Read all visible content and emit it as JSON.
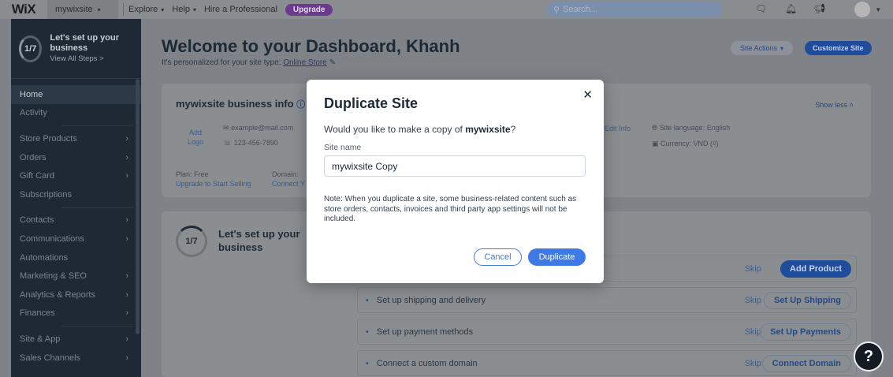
{
  "topbar": {
    "logo": "WiX",
    "site_name": "mywixsite",
    "nav": [
      "Explore",
      "Help",
      "Hire a Professional"
    ],
    "upgrade_label": "Upgrade",
    "search_placeholder": "Search..."
  },
  "sidebar": {
    "setup_progress": "1/7",
    "setup_title": "Let's set up your business",
    "setup_link": "View All Steps >",
    "items": [
      {
        "label": "Home",
        "has_chevron": false,
        "active": true
      },
      {
        "label": "Activity",
        "has_chevron": false
      },
      {
        "label": "Store Products",
        "has_chevron": true
      },
      {
        "label": "Orders",
        "has_chevron": true
      },
      {
        "label": "Gift Card",
        "has_chevron": true
      },
      {
        "label": "Subscriptions",
        "has_chevron": false
      },
      {
        "label": "Contacts",
        "has_chevron": true
      },
      {
        "label": "Communications",
        "has_chevron": true
      },
      {
        "label": "Automations",
        "has_chevron": false
      },
      {
        "label": "Marketing & SEO",
        "has_chevron": true
      },
      {
        "label": "Analytics & Reports",
        "has_chevron": true
      },
      {
        "label": "Finances",
        "has_chevron": true
      },
      {
        "label": "Site & App",
        "has_chevron": true
      },
      {
        "label": "Sales Channels",
        "has_chevron": true
      }
    ]
  },
  "main": {
    "title": "Welcome to your Dashboard, Khanh",
    "subtitle_prefix": "It's personalized for your site type:",
    "site_type": "Online Store",
    "site_actions": "Site Actions",
    "customize": "Customize Site",
    "business_info": {
      "title": "mywixsite business info",
      "add_logo": "Add Logo",
      "email": "example@mail.com",
      "phone": "123-456-7890",
      "edit_info": "Edit Info",
      "language": "Site language: English",
      "currency": "Currency: VND (₫)",
      "plan": "Plan: Free",
      "upgrade_link": "Upgrade to Start Selling",
      "domain": "Domain: ",
      "connect": "Connect Y",
      "show_less": "Show less"
    },
    "setup_card": {
      "progress": "1/7",
      "title": "Let's set up your business",
      "tasks": [
        {
          "label": "",
          "skip": "Skip",
          "cta": "Add Product",
          "primary": true
        },
        {
          "label": "Set up shipping and delivery",
          "skip": "Skip",
          "cta": "Set Up Shipping"
        },
        {
          "label": "Set up payment methods",
          "skip": "Skip",
          "cta": "Set Up Payments"
        },
        {
          "label": "Connect a custom domain",
          "skip": "Skip",
          "cta": "Connect Domain"
        }
      ]
    }
  },
  "modal": {
    "title": "Duplicate Site",
    "question_prefix": "Would you like to make a copy of ",
    "site": "mywixsite",
    "question_suffix": "?",
    "site_name_label": "Site name",
    "site_name_value": "mywixsite Copy",
    "note": "Note: When you duplicate a site, some business-related content such as store orders, contacts, invoices and third party app settings will not be included.",
    "cancel": "Cancel",
    "duplicate": "Duplicate"
  },
  "help_label": "?"
}
